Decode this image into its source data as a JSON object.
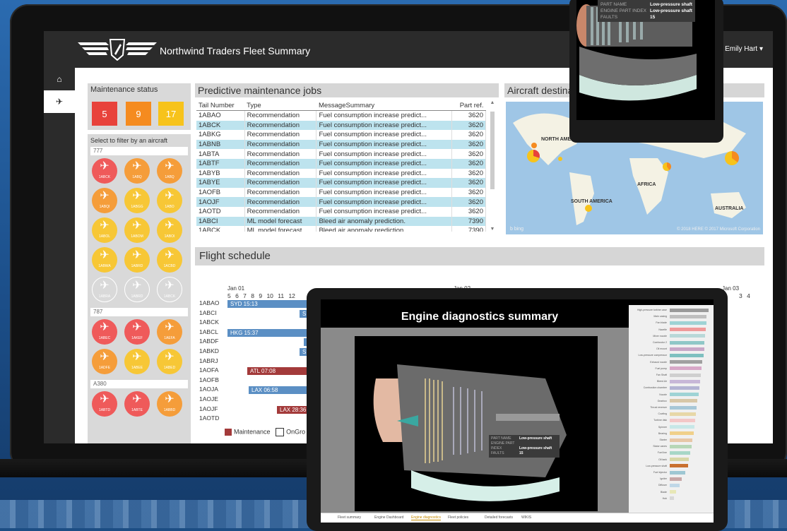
{
  "app": {
    "title": "Northwind Traders Fleet Summary",
    "user": "Emily Hart ▾"
  },
  "rail": {
    "home_icon": "⌂",
    "plane_icon": "✈"
  },
  "maintenance": {
    "title": "Maintenance status",
    "counts": [
      {
        "value": "5",
        "color": "#e8423b"
      },
      {
        "value": "9",
        "color": "#f58b1f"
      },
      {
        "value": "17",
        "color": "#f7c31b"
      }
    ]
  },
  "filter": {
    "title": "Select to filter by an aircraft",
    "groups": [
      {
        "label": "777",
        "planes": [
          {
            "code": "1ABCK",
            "color": "#ef5a5a"
          },
          {
            "code": "1ABQ",
            "color": "#f59d3a"
          },
          {
            "code": "1ABQ",
            "color": "#f59d3a"
          },
          {
            "code": "1ABQI",
            "color": "#f59d3a"
          },
          {
            "code": "1ABGG",
            "color": "#f7c736"
          },
          {
            "code": "1ABO",
            "color": "#f7c736"
          },
          {
            "code": "1ABOL",
            "color": "#f7c736"
          },
          {
            "code": "1ABOM",
            "color": "#f7c736"
          },
          {
            "code": "1ABOI",
            "color": "#f7c736"
          },
          {
            "code": "1ABWA",
            "color": "#f7c736"
          },
          {
            "code": "1ABRD",
            "color": "#f7c736"
          },
          {
            "code": "1ACBD",
            "color": "#f7c736"
          },
          {
            "code": "1ABRA",
            "color": "outline"
          },
          {
            "code": "1ABRD",
            "color": "outline"
          },
          {
            "code": "1ABCK",
            "color": "outline"
          }
        ]
      },
      {
        "label": "787",
        "planes": [
          {
            "code": "1ABEC",
            "color": "#ef5a5a"
          },
          {
            "code": "1AKEF",
            "color": "#ef5a5a"
          },
          {
            "code": "1AEFA",
            "color": "#f59d3a"
          },
          {
            "code": "1ADFE",
            "color": "#f59d3a"
          },
          {
            "code": "1ABEE",
            "color": "#f7c736"
          },
          {
            "code": "1ABED",
            "color": "#f7c736"
          }
        ]
      },
      {
        "label": "A380",
        "planes": [
          {
            "code": "1ABTD",
            "color": "#ef5a5a"
          },
          {
            "code": "1ABTE",
            "color": "#ef5a5a"
          },
          {
            "code": "1ABBD",
            "color": "#f59d3a"
          }
        ]
      }
    ]
  },
  "jobs": {
    "title": "Predictive maintenance jobs",
    "columns": [
      "Tail Number",
      "Type",
      "MessageSummary",
      "Part ref."
    ],
    "rows": [
      [
        "1ABAO",
        "Recommendation",
        "Fuel consumption increase predict...",
        "3620",
        false
      ],
      [
        "1ABCK",
        "Recommendation",
        "Fuel consumption increase predict...",
        "3620",
        true
      ],
      [
        "1ABKG",
        "Recommendation",
        "Fuel consumption increase predict...",
        "3620",
        false
      ],
      [
        "1ABNB",
        "Recommendation",
        "Fuel consumption increase predict...",
        "3620",
        true
      ],
      [
        "1ABTA",
        "Recommendation",
        "Fuel consumption increase predict...",
        "3620",
        false
      ],
      [
        "1ABTF",
        "Recommendation",
        "Fuel consumption increase predict...",
        "3620",
        true
      ],
      [
        "1ABYB",
        "Recommendation",
        "Fuel consumption increase predict...",
        "3620",
        false
      ],
      [
        "1ABYE",
        "Recommendation",
        "Fuel consumption increase predict...",
        "3620",
        true
      ],
      [
        "1AOFB",
        "Recommendation",
        "Fuel consumption increase predict...",
        "3620",
        false
      ],
      [
        "1AOJF",
        "Recommendation",
        "Fuel consumption increase predict...",
        "3620",
        true
      ],
      [
        "1AOTD",
        "Recommendation",
        "Fuel consumption increase predict...",
        "3620",
        false
      ],
      [
        "1ABCI",
        "ML model forecast",
        "Bleed air anomaly prediction.",
        "7390",
        true
      ],
      [
        "1ABCK",
        "ML model forecast",
        "Bleed air anomaly prediction.",
        "7390",
        false
      ]
    ]
  },
  "map": {
    "title": "Aircraft destinations",
    "labels": [
      "NORTH AMERICA",
      "AFRICA",
      "SOUTH AMERICA",
      "AUSTRALIA"
    ],
    "bing": "b bing",
    "credit": "© 2018 HERE  © 2017 Microsoft Corporation"
  },
  "schedule": {
    "title": "Flight schedule",
    "dates": [
      "Jan 01",
      "Jan 02",
      "Jan 03"
    ],
    "days": "5 6 7 8 9 10 11 12",
    "days_end": "3 4",
    "tails": [
      "1ABAO",
      "1ABCI",
      "1ABCK",
      "1ABCL",
      "1ABDF",
      "1ABKD",
      "1ABRJ",
      "1AOFA",
      "1AOFB",
      "1AOJA",
      "1AOJE",
      "1AOJF",
      "1AOTD"
    ],
    "bars": [
      {
        "label": "SYD 15:13",
        "color": "#5b8fc4"
      },
      {
        "label": "SEA",
        "color": "#5b8fc4"
      },
      {
        "label": "HKG 15:37",
        "color": "#5b8fc4"
      },
      {
        "label": "HK",
        "color": "#5b8fc4"
      },
      {
        "label": "SEA",
        "color": "#5b8fc4"
      },
      {
        "label": "ATL 07:08",
        "color": "#a33a3a"
      },
      {
        "label": "LAX 06:58",
        "color": "#5b8fc4"
      },
      {
        "label": "LAX 28:36",
        "color": "#a33a3a"
      }
    ],
    "legend": {
      "maintenance": "Maintenance",
      "onground": "OnGro"
    }
  },
  "tablet_top": {
    "tooltip": [
      [
        "PART NAME",
        "Low-pressure shaft"
      ],
      [
        "ENGINE PART INDEX",
        "Low-pressure shaft"
      ],
      [
        "FAULTS",
        "15"
      ]
    ]
  },
  "engine": {
    "title": "Engine diagnostics summary",
    "tooltip": [
      [
        "PART NAME",
        "Low-pressure shaft"
      ],
      [
        "ENGINE PART INDEX",
        "Low-pressure shaft"
      ],
      [
        "FAULTS",
        "15"
      ]
    ],
    "tabs": [
      "Fleet summary",
      "Engine Dashboard",
      "Engine diagnostics",
      "Fleet policies",
      "Detailed forecasts",
      "WIKIS"
    ],
    "active_tab": 2,
    "side_rows": [
      {
        "label": "High-pressure turbine case",
        "value": 0.95,
        "color": "#9a9a9a"
      },
      {
        "label": "Main casing",
        "value": 0.9,
        "color": "#bfbfbf"
      },
      {
        "label": "Fan blade",
        "value": 0.9,
        "color": "#9ed3d5"
      },
      {
        "label": "Nacelle",
        "value": 0.88,
        "color": "#ef9a9a"
      },
      {
        "label": "Mixer nozzle",
        "value": 0.86,
        "color": "#b8d8d8"
      },
      {
        "label": "Combustor 2",
        "value": 0.85,
        "color": "#8fc7c7"
      },
      {
        "label": "Oil mount",
        "value": 0.84,
        "color": "#c7a7c7"
      },
      {
        "label": "Low-pressure compressor",
        "value": 0.82,
        "color": "#7ec0c0"
      },
      {
        "label": "Exhaust nozzle",
        "value": 0.8,
        "color": "#a0a0a0"
      },
      {
        "label": "Fuel pump",
        "value": 0.78,
        "color": "#d7a7c7"
      },
      {
        "label": "Fan Shaft",
        "value": 0.76,
        "color": "#cfcfcf"
      },
      {
        "label": "Bleed Air",
        "value": 0.74,
        "color": "#c7b7d7"
      },
      {
        "label": "Combustion chamber",
        "value": 0.72,
        "color": "#b3b3d3"
      },
      {
        "label": "Nozzle",
        "value": 0.7,
        "color": "#9ed3d5"
      },
      {
        "label": "Gearbox",
        "value": 0.68,
        "color": "#d7c7a7"
      },
      {
        "label": "Thrust reverser",
        "value": 0.66,
        "color": "#a7c7d7"
      },
      {
        "label": "Cowling",
        "value": 0.64,
        "color": "#e7d7a7"
      },
      {
        "label": "Turbine disk",
        "value": 0.62,
        "color": "#f3c7c7"
      },
      {
        "label": "Spinner",
        "value": 0.6,
        "color": "#c7e7e7"
      },
      {
        "label": "Bearing",
        "value": 0.58,
        "color": "#f0d08a"
      },
      {
        "label": "Starter",
        "value": 0.56,
        "color": "#e7c7a7"
      },
      {
        "label": "Stator vanes",
        "value": 0.54,
        "color": "#b7d7b7"
      },
      {
        "label": "Fuel line",
        "value": 0.5,
        "color": "#a7d7c7"
      },
      {
        "label": "Oil tank",
        "value": 0.46,
        "color": "#d7d7a7"
      },
      {
        "label": "Low-pressure shaft",
        "value": 0.44,
        "color": "#c9712f"
      },
      {
        "label": "Fuel injector",
        "value": 0.38,
        "color": "#9ec7d3"
      },
      {
        "label": "Igniter",
        "value": 0.3,
        "color": "#c7a7a7"
      },
      {
        "label": "Diffuser",
        "value": 0.24,
        "color": "#bfd7e7"
      },
      {
        "label": "Blade",
        "value": 0.16,
        "color": "#e7e7b7"
      },
      {
        "label": "Hub",
        "value": 0.1,
        "color": "#d7d7d7"
      }
    ]
  }
}
